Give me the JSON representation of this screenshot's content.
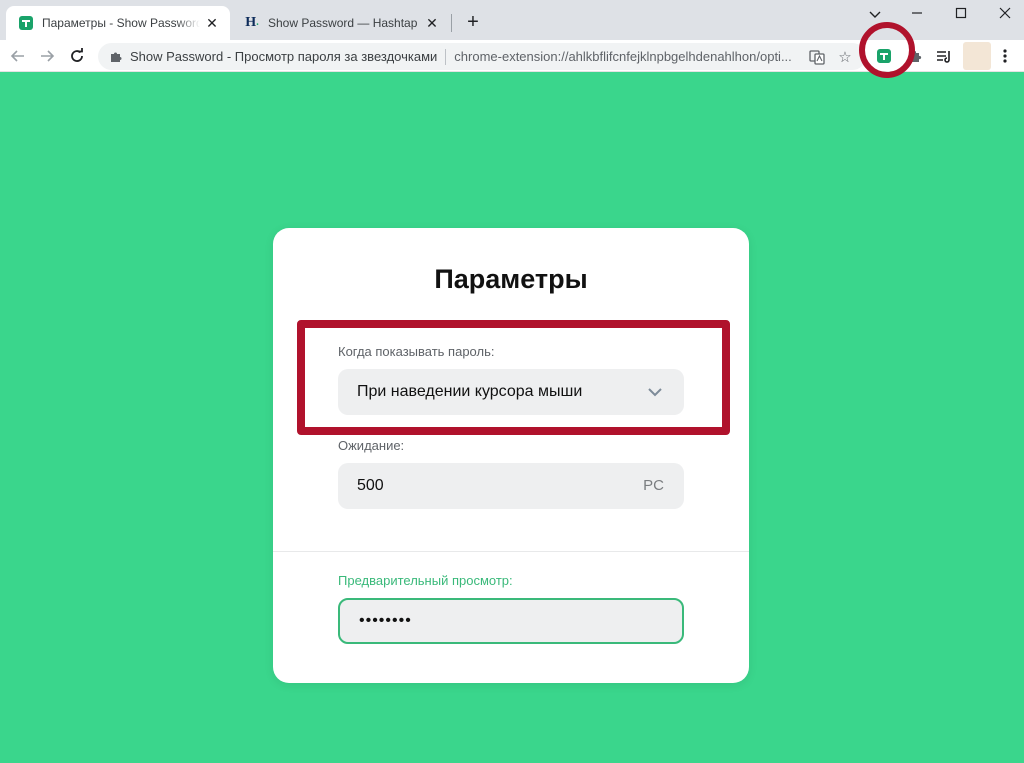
{
  "browser": {
    "tabs": [
      {
        "title": "Параметры - Show Password - Про",
        "favicon": "show-password-icon",
        "active": true
      },
      {
        "title": "Show Password — Hashtap",
        "favicon": "hashtap-icon",
        "favicon_text": "H",
        "active": false
      }
    ],
    "new_tab_symbol": "+",
    "omnibox": {
      "site_name": "Show Password - Просмотр пароля за звездочками",
      "url": "chrome-extension://ahlkbflifcnfejklnpbgelhdenahlhon/opti..."
    }
  },
  "settings": {
    "title": "Параметры",
    "show_mode": {
      "label": "Когда показывать пароль:",
      "value": "При наведении курсора мыши"
    },
    "wait": {
      "label": "Ожидание:",
      "value": "500",
      "unit": "PC"
    },
    "preview": {
      "label": "Предварительный просмотр:",
      "value": "••••••••"
    }
  },
  "colors": {
    "page_background": "#3ad68c",
    "accent_green": "#3ab97a",
    "highlight_red": "#b0122c"
  }
}
